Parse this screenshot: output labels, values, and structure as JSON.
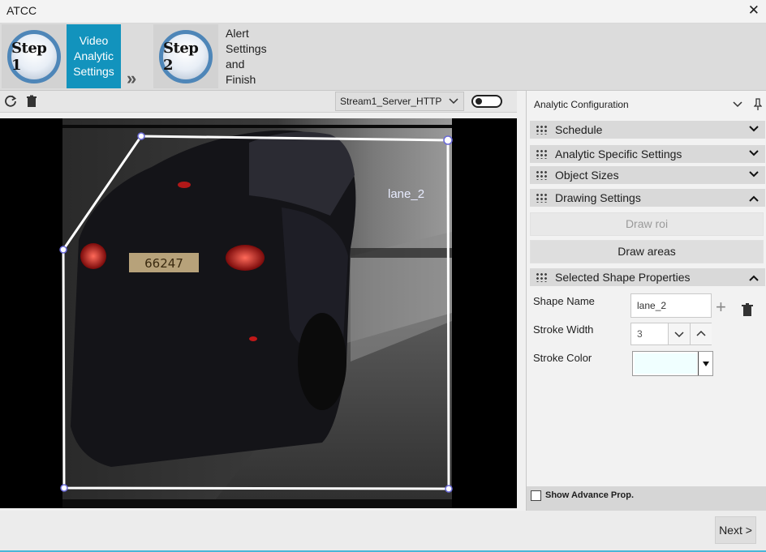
{
  "window": {
    "title": "ATCC",
    "close_icon": "close-icon"
  },
  "wizard": {
    "steps": [
      {
        "badge": "Step 1",
        "label": "Video Analytic Settings",
        "active": true
      },
      {
        "badge": "Step 2",
        "label": "Alert Settings and Finish",
        "active": false
      }
    ],
    "separator_icon": "double-chevron-right-icon"
  },
  "video_toolbar": {
    "refresh_icon": "refresh-icon",
    "delete_icon": "trash-icon",
    "stream": {
      "selected": "Stream1_Server_HTTP"
    },
    "toggle": {
      "on": false
    }
  },
  "video": {
    "shape_label": "lane_2",
    "plate_text": "66247"
  },
  "config_panel": {
    "title": "Analytic Configuration",
    "sections": {
      "schedule": "Schedule",
      "analytic_specific": "Analytic Specific Settings",
      "object_sizes": "Object Sizes",
      "drawing": "Drawing Settings",
      "selected_shape": "Selected Shape Properties"
    },
    "drawing": {
      "draw_roi": "Draw roi",
      "draw_areas": "Draw areas"
    },
    "shape_props": {
      "name_label": "Shape Name",
      "name_value": "lane_2",
      "width_label": "Stroke Width",
      "width_value": "3",
      "color_label": "Stroke Color",
      "color_value": "#f0ffff"
    },
    "advance": {
      "label": "Show Advance Prop.",
      "checked": false
    }
  },
  "footer": {
    "next_label": "Next >"
  },
  "colors": {
    "accent": "#1293bd",
    "badge_ring": "#4e86b8",
    "shape_stroke": "#ffffff"
  }
}
